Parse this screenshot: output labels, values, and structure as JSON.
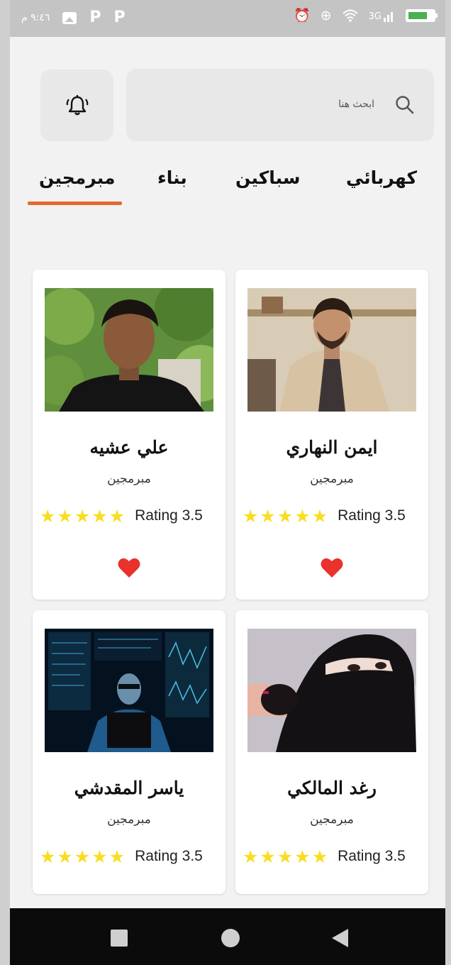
{
  "status_bar": {
    "time": "٩:٤٦ م",
    "signal_label": "3G",
    "icons": [
      "gallery-icon",
      "p-app-icon",
      "p-app-icon",
      "alarm-icon",
      "data-saver-icon",
      "wifi-icon",
      "signal-icon",
      "battery-icon"
    ],
    "battery_color": "#4caf50"
  },
  "header": {
    "search_placeholder": "ابحث هنا",
    "bell_icon": "bell-ring-icon"
  },
  "tabs": [
    {
      "label": "كهربائي",
      "active": false
    },
    {
      "label": "سباكين",
      "active": false
    },
    {
      "label": "بناء",
      "active": false
    },
    {
      "label": "مبرمجين",
      "active": true
    }
  ],
  "accent_color": "#e36a2e",
  "star_color": "#f9dd1f",
  "heart_color": "#e8322b",
  "cards": [
    {
      "name": "علي عشيه",
      "role": "مبرمجين",
      "rating_text": "Rating 3.5",
      "stars": 5,
      "favorite": true
    },
    {
      "name": "ايمن النهاري",
      "role": "مبرمجين",
      "rating_text": "Rating 3.5",
      "stars": 5,
      "favorite": true
    },
    {
      "name": "ياسر المقدشي",
      "role": "مبرمجين",
      "rating_text": "Rating 3.5",
      "stars": 5,
      "favorite": false
    },
    {
      "name": "رغد المالكي",
      "role": "مبرمجين",
      "rating_text": "Rating 3.5",
      "stars": 5,
      "favorite": false
    }
  ],
  "nav_bar": {
    "icons": [
      "recent-apps-icon",
      "home-icon",
      "back-icon"
    ]
  }
}
